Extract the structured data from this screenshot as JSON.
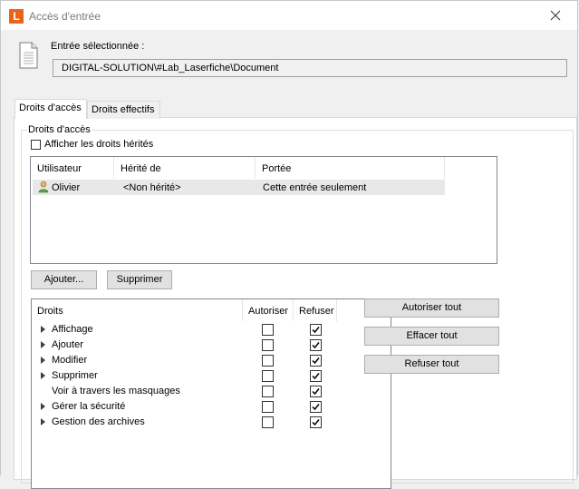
{
  "window": {
    "app_icon_letter": "L",
    "title": "Accès d'entrée"
  },
  "selection": {
    "label": "Entrée sélectionnée :",
    "path": "DIGITAL-SOLUTION\\#Lab_Laserfiche\\Document"
  },
  "tabs": [
    {
      "label": "Droits d'accès",
      "active": true
    },
    {
      "label": "Droits effectifs",
      "active": false
    }
  ],
  "access": {
    "group_label": "Droits d'accès",
    "show_inherited_label": "Afficher les droits hérités",
    "show_inherited_checked": false,
    "columns": [
      "Utilisateur",
      "Hérité de",
      "Portée"
    ],
    "rows": [
      {
        "user": "Olivier",
        "inherited": "<Non hérité>",
        "scope": "Cette entrée seulement"
      }
    ],
    "add_button": "Ajouter...",
    "remove_button": "Supprimer"
  },
  "rights": {
    "columns": [
      "Droits",
      "Autoriser",
      "Refuser"
    ],
    "items": [
      {
        "name": "Affichage",
        "expandable": true,
        "allow": false,
        "deny": true
      },
      {
        "name": "Ajouter",
        "expandable": true,
        "allow": false,
        "deny": true
      },
      {
        "name": "Modifier",
        "expandable": true,
        "allow": false,
        "deny": true
      },
      {
        "name": "Supprimer",
        "expandable": true,
        "allow": false,
        "deny": true
      },
      {
        "name": "Voir à travers les masquages",
        "expandable": false,
        "allow": false,
        "deny": true
      },
      {
        "name": "Gérer la sécurité",
        "expandable": true,
        "allow": false,
        "deny": true
      },
      {
        "name": "Gestion des archives",
        "expandable": true,
        "allow": false,
        "deny": true
      }
    ],
    "allow_all_button": "Autoriser tout",
    "clear_all_button": "Effacer tout",
    "deny_all_button": "Refuser tout"
  },
  "colors": {
    "app_icon": "#e8641c",
    "selected_row": "#e8e8e8"
  }
}
